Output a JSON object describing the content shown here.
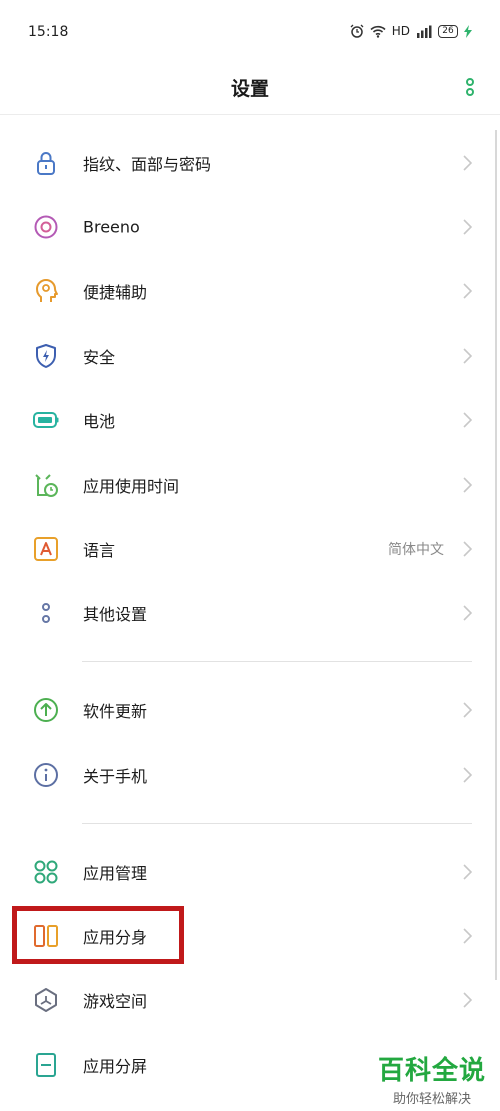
{
  "status_bar": {
    "time": "15:18",
    "network": "HD",
    "battery": "26"
  },
  "header": {
    "title": "设置"
  },
  "items": [
    {
      "label": "指纹、面部与密码",
      "value": ""
    },
    {
      "label": "Breeno",
      "value": ""
    },
    {
      "label": "便捷辅助",
      "value": ""
    },
    {
      "label": "安全",
      "value": ""
    },
    {
      "label": "电池",
      "value": ""
    },
    {
      "label": "应用使用时间",
      "value": ""
    },
    {
      "label": "语言",
      "value": "简体中文"
    },
    {
      "label": "其他设置",
      "value": ""
    },
    {
      "label": "软件更新",
      "value": ""
    },
    {
      "label": "关于手机",
      "value": ""
    },
    {
      "label": "应用管理",
      "value": ""
    },
    {
      "label": "应用分身",
      "value": ""
    },
    {
      "label": "游戏空间",
      "value": ""
    },
    {
      "label": "应用分屏",
      "value": ""
    }
  ],
  "watermark": {
    "main": "百科全说",
    "sub": "助你轻松解决"
  },
  "colors": {
    "highlight": "#c0191a",
    "watermark": "#23a840",
    "accent": "#2fb36d"
  }
}
